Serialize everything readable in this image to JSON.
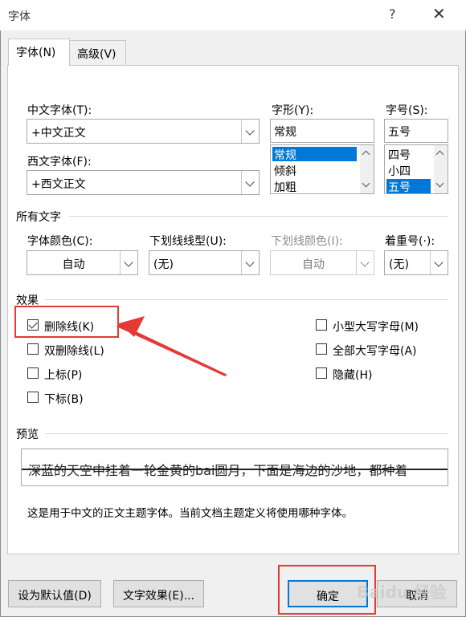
{
  "window": {
    "title": "字体",
    "help_icon": "?",
    "close_icon": "✕"
  },
  "tabs": [
    {
      "label": "字体(N)",
      "active": true
    },
    {
      "label": "高级(V)",
      "active": false
    }
  ],
  "font": {
    "chinese_font_label": "中文字体(T):",
    "chinese_font_value": "+中文正文",
    "western_font_label": "西文字体(F):",
    "western_font_value": "+西文正文",
    "style_label": "字形(Y):",
    "style_value": "常规",
    "style_options": [
      "常规",
      "倾斜",
      "加粗"
    ],
    "style_selected": "常规",
    "size_label": "字号(S):",
    "size_value": "五号",
    "size_options": [
      "四号",
      "小四",
      "五号"
    ],
    "size_selected": "五号"
  },
  "all_text": {
    "section_label": "所有文字",
    "font_color_label": "字体颜色(C):",
    "font_color_value": "自动",
    "underline_type_label": "下划线线型(U):",
    "underline_type_value": "(无)",
    "underline_color_label": "下划线颜色(I):",
    "underline_color_value": "自动",
    "emphasis_label": "着重号(·):",
    "emphasis_value": "(无)"
  },
  "effects": {
    "section_label": "效果",
    "left": [
      {
        "label": "删除线(K)",
        "checked": true
      },
      {
        "label": "双删除线(L)",
        "checked": false
      },
      {
        "label": "上标(P)",
        "checked": false
      },
      {
        "label": "下标(B)",
        "checked": false
      }
    ],
    "right": [
      {
        "label": "小型大写字母(M)",
        "checked": false
      },
      {
        "label": "全部大写字母(A)",
        "checked": false
      },
      {
        "label": "隐藏(H)",
        "checked": false
      }
    ]
  },
  "preview": {
    "section_label": "预览",
    "sample_text": "深蓝的天空中挂着一轮金黄的bai圆月，下面是海边的沙地，都种着",
    "description": "这是用于中文的正文主题字体。当前文档主题定义将使用哪种字体。"
  },
  "buttons": {
    "set_default": "设为默认值(D)",
    "text_effects": "文字效果(E)...",
    "ok": "确定",
    "cancel": "取消"
  },
  "watermark": "Baidu 经验",
  "colors": {
    "selection": "#0078d7",
    "annotation": "#e53935"
  }
}
